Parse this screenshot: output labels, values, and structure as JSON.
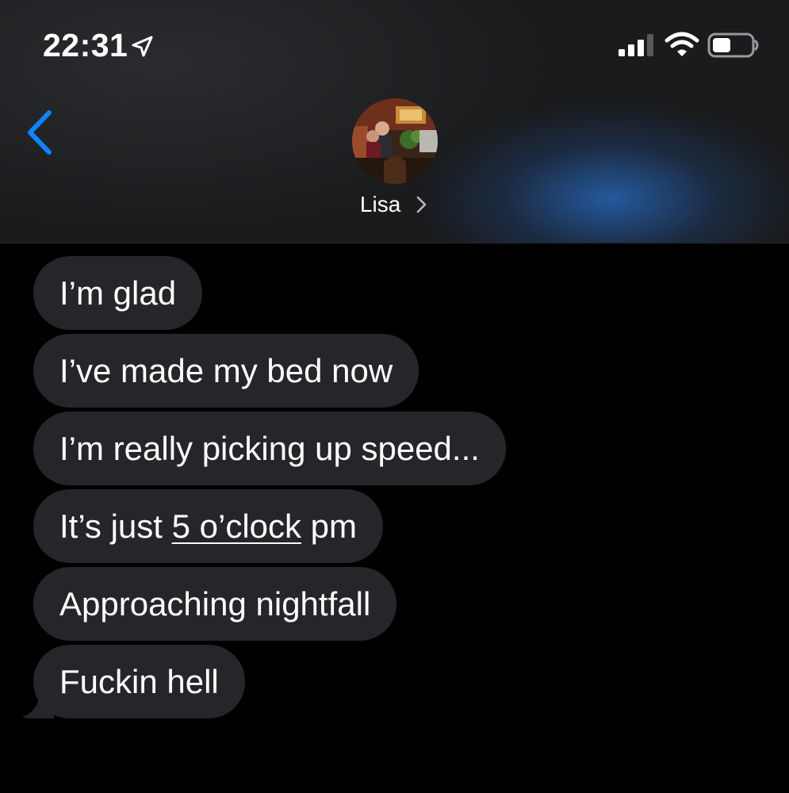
{
  "status_bar": {
    "time": "22:31",
    "icons": [
      "location-arrow-icon",
      "cellular-signal-icon",
      "wifi-icon",
      "battery-icon"
    ]
  },
  "header": {
    "contact_name": "Lisa",
    "back_icon": "chevron-left-icon",
    "name_chevron_icon": "chevron-right-icon"
  },
  "messages": [
    {
      "text": "I’m glad"
    },
    {
      "text": "I’ve made my bed now"
    },
    {
      "text": "I’m really picking up speed..."
    },
    {
      "before": "It’s just ",
      "link": "5 o’clock",
      "after": " pm"
    },
    {
      "text": "Approaching nightfall"
    },
    {
      "text": "Fuckin hell"
    }
  ],
  "colors": {
    "accent": "#0a84ff",
    "bubble_incoming": "#26262a",
    "background": "#000000"
  }
}
